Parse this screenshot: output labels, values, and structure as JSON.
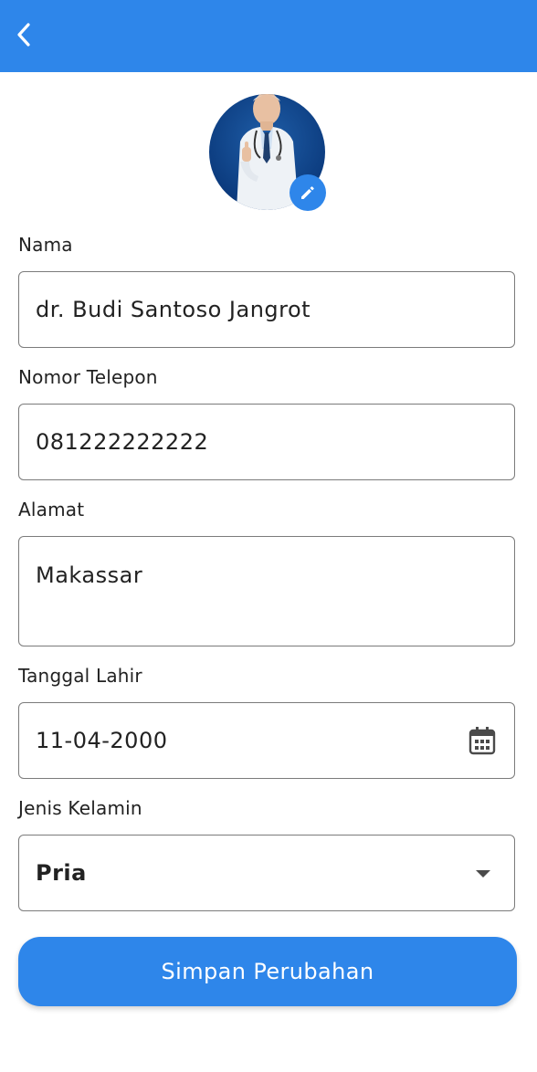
{
  "colors": {
    "accent": "#2e86ea",
    "border": "#7b7b7b",
    "text": "#222222"
  },
  "appbar": {
    "back_icon": "chevron-left-icon"
  },
  "profile": {
    "avatar_icon": "doctor-avatar",
    "edit_icon": "pencil-icon"
  },
  "form": {
    "nama": {
      "label": "Nama",
      "value": "dr. Budi Santoso Jangrot"
    },
    "telepon": {
      "label": "Nomor Telepon",
      "value": "081222222222"
    },
    "alamat": {
      "label": "Alamat",
      "value": "Makassar"
    },
    "tanggal_lahir": {
      "label": "Tanggal Lahir",
      "value": "11-04-2000",
      "icon": "calendar-icon"
    },
    "jenis_kelamin": {
      "label": "Jenis Kelamin",
      "value": "Pria",
      "icon": "dropdown-arrow-icon"
    }
  },
  "save_button": {
    "label": "Simpan Perubahan"
  }
}
